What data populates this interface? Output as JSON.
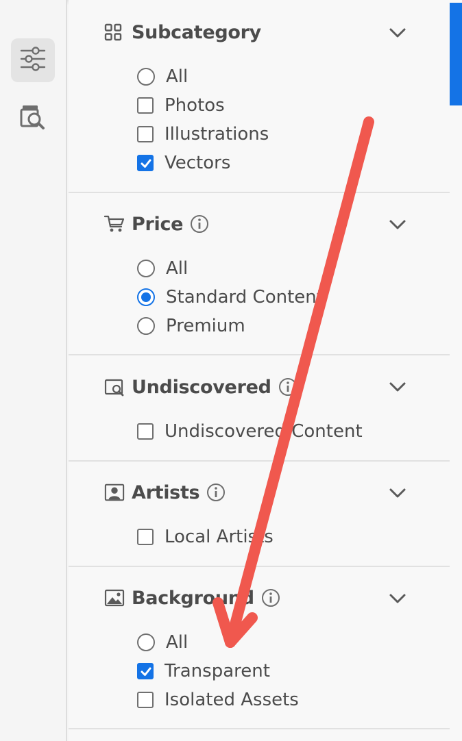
{
  "colors": {
    "accent": "#1473e6",
    "annotation_arrow": "#f0584e"
  },
  "rail": {
    "items": [
      {
        "icon": "filter-sliders-icon",
        "active": true
      },
      {
        "icon": "visual-search-icon",
        "active": false
      }
    ]
  },
  "filters": {
    "subcategory": {
      "title": "Subcategory",
      "icon": "grid-icon",
      "options": [
        {
          "label": "All",
          "type": "radio",
          "checked": false
        },
        {
          "label": "Photos",
          "type": "checkbox",
          "checked": false
        },
        {
          "label": "Illustrations",
          "type": "checkbox",
          "checked": false
        },
        {
          "label": "Vectors",
          "type": "checkbox",
          "checked": true
        }
      ]
    },
    "price": {
      "title": "Price",
      "icon": "cart-icon",
      "options": [
        {
          "label": "All",
          "type": "radio",
          "checked": false
        },
        {
          "label": "Standard Content",
          "type": "radio",
          "checked": true
        },
        {
          "label": "Premium",
          "type": "radio",
          "checked": false
        }
      ]
    },
    "undiscovered": {
      "title": "Undiscovered",
      "icon": "image-search-icon",
      "options": [
        {
          "label": "Undiscovered Content",
          "type": "checkbox",
          "checked": false
        }
      ]
    },
    "artists": {
      "title": "Artists",
      "icon": "artist-icon",
      "options": [
        {
          "label": "Local Artists",
          "type": "checkbox",
          "checked": false
        }
      ]
    },
    "background": {
      "title": "Background",
      "icon": "image-icon",
      "options": [
        {
          "label": "All",
          "type": "radio",
          "checked": false
        },
        {
          "label": "Transparent",
          "type": "checkbox",
          "checked": true
        },
        {
          "label": "Isolated Assets",
          "type": "checkbox",
          "checked": false
        }
      ]
    }
  }
}
